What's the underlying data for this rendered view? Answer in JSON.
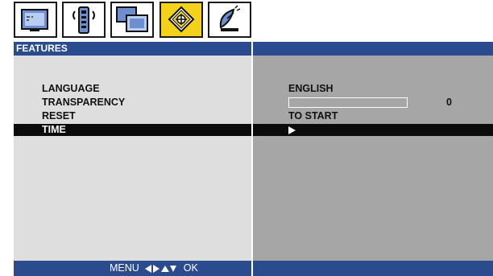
{
  "tabs": [
    {
      "icon": "picture-icon",
      "active": false
    },
    {
      "icon": "sound-remote-icon",
      "active": false
    },
    {
      "icon": "screens-icon",
      "active": false
    },
    {
      "icon": "features-icon",
      "active": true
    },
    {
      "icon": "satellite-icon",
      "active": false
    }
  ],
  "header": {
    "title": "FEATURES"
  },
  "menu": {
    "language": {
      "label": "LANGUAGE",
      "value": "ENGLISH"
    },
    "transparency": {
      "label": "TRANSPARENCY",
      "value": "0",
      "level": 0
    },
    "reset": {
      "label": "RESET",
      "value": "TO START"
    },
    "time": {
      "label": "TIME",
      "selected": true
    }
  },
  "footer": {
    "menu_label": "MENU",
    "ok_label": "OK"
  },
  "colors": {
    "header_blue": "#2a4b8e",
    "left_panel": "#dedede",
    "right_panel": "#a6a6a6",
    "selected_row": "#0b0b0b",
    "active_tab": "#f4d21a"
  }
}
